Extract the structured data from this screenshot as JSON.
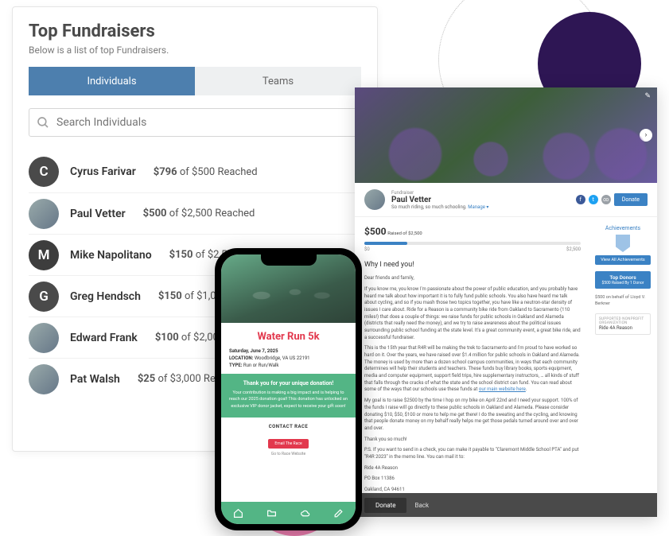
{
  "left": {
    "title": "Top Fundraisers",
    "subtitle": "Below is a list of top Fundraisers.",
    "tabs": {
      "individuals": "Individuals",
      "teams": "Teams"
    },
    "search_placeholder": "Search Individuals",
    "rows": [
      {
        "initial": "C",
        "color": "#4a4a4a",
        "name": "Cyrus Farivar",
        "amount": "$796",
        "goal_text": "of $500 Reached"
      },
      {
        "img": true,
        "name": "Paul Vetter",
        "amount": "$500",
        "goal_text": "of $2,500 Reached"
      },
      {
        "initial": "M",
        "color": "#3d3d3d",
        "name": "Mike Napolitano",
        "amount": "$150",
        "goal_text": "of $2,500 Reached"
      },
      {
        "initial": "G",
        "color": "#4a4a4a",
        "name": "Greg Hendsch",
        "amount": "$150",
        "goal_text": "of $1,000 Reached"
      },
      {
        "img": true,
        "name": "Edward Frank",
        "amount": "$100",
        "goal_text": "of $2,000 Reached"
      },
      {
        "img": true,
        "name": "Pat Walsh",
        "amount": "$25",
        "goal_text": "of $3,000 Reached"
      }
    ]
  },
  "phone": {
    "event_title": "Water Run 5k",
    "date": "Saturday, June 7, 2025",
    "location_label": "LOCATION:",
    "location": "Woodbridge, VA US 22191",
    "type_label": "TYPE:",
    "type": "Run or Run/Walk",
    "thanks_headline": "Thank you for your unique donation!",
    "thanks_body": "Your contribution is making a big impact and is helping to reach our 2025 donation goal! This donation has unlocked an exclusive VIP donor jacket, expect to receive your gift soon!",
    "contact_label": "CONTACT RACE",
    "contact_button": "Email The Race",
    "website_link": "Go to Race Website"
  },
  "profile": {
    "role": "Fundraiser",
    "name": "Paul Vetter",
    "tagline": "So much riding, so much schooling.",
    "manage": "Manage ▾",
    "donate": "Donate",
    "raised": "$500",
    "raised_label": "Raised of $2,500",
    "bar_min": "$0",
    "bar_max": "$2,500",
    "heading": "Why I need you!",
    "p_greet": "Dear friends and family,",
    "p1": "If you know me, you know I'm passionate about the power of public education, and you probably have heard me talk about how important it is to fully fund public schools. You also have heard me talk about cycling, and so if you mash those two topics together, you have like a neutron-star density of issues I care about. Ride for a Reason is a community bike ride from Oakland to Sacramento (110 miles!) that does a couple of things: we raise funds for public schools in Oakland and Alameda (districts that really need the money), and we try to raise awareness about the political issues surrounding public school funding at the state level. It's a great community event, a great bike ride, and a successful fundraiser.",
    "p2_a": "This is the 15th year that R4R will be making the trek to Sacramento and I'm proud to have worked so hard on it. Over the years, we have raised over $1.4 million for public schools in Oakland and Alameda. The money is used by more than a dozen school campus communities, in ways that each community determines will help their students and teachers. These funds buy library books, sports equipment, media and computer equipment, support field trips, hire supplementary instructors, … all kinds of stuff that falls through the cracks of what the state and the school district can fund. You can read about some of the ways that our schools use these funds at ",
    "p2_link": "our main website here",
    "p2_b": ".",
    "p3": "My goal is to raise $2500 by the time I hop on my bike on April 22nd and I need your support. 100% of the funds I raise will go directly to these public schools in Oakland and Alameda. Please consider donating $10, $50, $100 or more to help me get there! I do the sweating and the cycling, and knowing that people donate money on my behalf really helps me get those pedals turned around over and over and over.",
    "p4": "Thank you so much!",
    "p5": "P.S. If you want to send in a check, you can make it payable to \"Claremont Middle School PTA\" and put \"R4R 2023\" in the memo line.  You can mail it to:",
    "addr1": "Ride 4A Reason",
    "addr2": "PO Box 11386",
    "addr3": "Oakland, CA  94611",
    "ach_title": "Achievements",
    "ach_viewall": "View All Achievements",
    "topdonors_title": "Top Donors",
    "topdonors_sub": "$500 Raised By 1 Donor",
    "donor_line": "$500 on behalf of Lloyd V. Berkner",
    "org_label": "SUPPORTED NONPROFIT ORGANIZATION",
    "org_name": "Ride 4A Reason",
    "footer_donate": "Donate",
    "footer_back": "Back"
  }
}
